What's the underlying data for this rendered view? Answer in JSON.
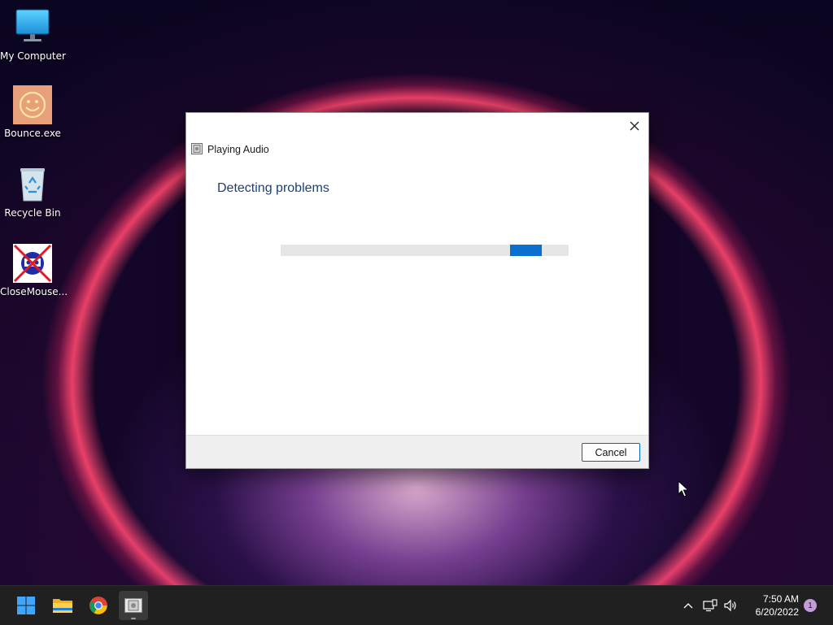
{
  "desktop": {
    "icons": [
      {
        "label": "My Computer",
        "icon": "monitor-icon"
      },
      {
        "label": "Bounce.exe",
        "icon": "smiley-icon"
      },
      {
        "label": "Recycle Bin",
        "icon": "recycle-bin-icon"
      },
      {
        "label": "CloseMouse...",
        "icon": "closemouse-icon"
      }
    ]
  },
  "dialog": {
    "title": "Playing Audio",
    "heading": "Detecting problems",
    "close_icon": "close-icon",
    "progress": {
      "indeterminate": true
    },
    "cancel_label": "Cancel"
  },
  "taskbar": {
    "apps": [
      {
        "name": "Start",
        "icon": "windows-start-icon"
      },
      {
        "name": "File Explorer",
        "icon": "folder-icon"
      },
      {
        "name": "Google Chrome",
        "icon": "chrome-icon"
      },
      {
        "name": "Troubleshooter",
        "icon": "troubleshooter-icon",
        "active": true
      }
    ],
    "tray": {
      "chevron_icon": "chevron-up-icon",
      "network_icon": "network-icon",
      "volume_icon": "speaker-icon"
    },
    "time": "7:50 AM",
    "date": "6/20/2022",
    "notifications": "1"
  },
  "colors": {
    "accent": "#0067c0",
    "progress": "#0b6fcf",
    "heading": "#1e3f73"
  }
}
